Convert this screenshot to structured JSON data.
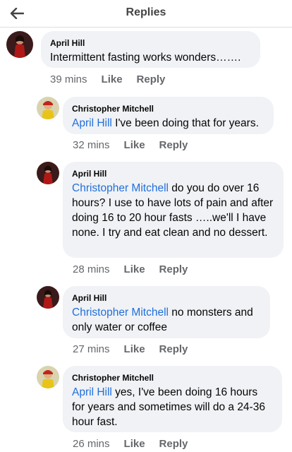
{
  "header": {
    "title": "Replies",
    "back_icon": "arrow-left-icon"
  },
  "actions": {
    "like": "Like",
    "reply": "Reply"
  },
  "comments": [
    {
      "author": "April Hill",
      "mention": "",
      "text": "Intermittent fasting works wonders…….",
      "time": "39 mins"
    },
    {
      "author": "Christopher Mitchell",
      "mention": "April Hill",
      "text": " I've been doing that for years.",
      "time": "32 mins"
    },
    {
      "author": "April Hill",
      "mention": "Christopher Mitchell",
      "text": " do you do over 16 hours? I use to have lots of pain and after doing 16 to 20 hour fasts …..we'll I have none. I try and eat clean and no dessert.",
      "time": "28 mins"
    },
    {
      "author": "April Hill",
      "mention": "Christopher Mitchell",
      "text": " no monsters and only water or coffee",
      "time": "27 mins"
    },
    {
      "author": "Christopher Mitchell",
      "mention": "April Hill",
      "text": " yes, I've been doing 16 hours for years and sometimes will do a 24-36 hour fast.",
      "time": "26 mins"
    }
  ],
  "colors": {
    "mention": "#216fdb",
    "bubble": "#f0f2f5",
    "meta": "#65676b"
  }
}
